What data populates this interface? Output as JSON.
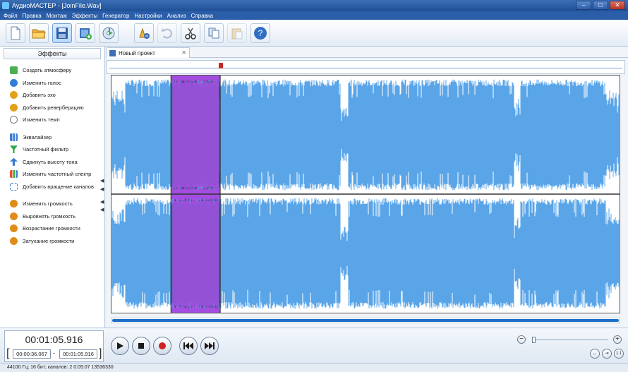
{
  "window": {
    "title": "АудиоМАСТЕР - [JoinFile.Wav]",
    "minimize": "–",
    "maximize": "□",
    "close": "✕"
  },
  "menu": [
    "Файл",
    "Правка",
    "Монтаж",
    "Эффекты",
    "Генератор",
    "Настройки",
    "Анализ",
    "Справка"
  ],
  "toolbar": {
    "icons": [
      "new-file-icon",
      "open-folder-icon",
      "save-icon",
      "video-icon",
      "audio-disc-icon",
      "effects-icon",
      "undo-icon",
      "cut-icon",
      "copy-icon",
      "paste-icon",
      "help-icon"
    ],
    "help_label": "?"
  },
  "effects_panel": {
    "header": "Эффекты",
    "groups": [
      [
        "Создать атмосферу",
        "Изменить голос",
        "Добавить эхо",
        "Добавить реверберацию",
        "Изменить темп"
      ],
      [
        "Эквалайзер",
        "Частотный фильтр",
        "Сдвинуть высоту тона",
        "Изменить частотный спектр",
        "Добавить вращение каналов"
      ],
      [
        "Изменить громкость",
        "Выровнять громкость",
        "Возрастание громкости",
        "Затухание громкости"
      ]
    ],
    "colors": {
      "atmosphere": "#4caf50",
      "voice": "#2f7fd6",
      "echo": "#e0a21a",
      "reverb": "#e0a21a",
      "tempo": "#7a7a7a",
      "eq": "#3a7bd5",
      "filter": "#2fa84f",
      "pitch": "#3a7bd5",
      "spectrum": "#e0542a",
      "rotation": "#2f7fd6",
      "volume": "#e08b1a"
    }
  },
  "tab": {
    "label": "Новый проект",
    "close": "✕"
  },
  "waveform": {
    "wave_color": "#5aa5e8",
    "selection_color": "#a34ee0",
    "selection_start": 0.117,
    "selection_end": 0.214
  },
  "time": {
    "current": "00:01:05.916",
    "selection_start": "00:00:36.067",
    "selection_end": "00:01:05.916",
    "dash": "-",
    "bracket_left": "[",
    "bracket_right": "]"
  },
  "zoom": {
    "minus": "−",
    "plus": "+",
    "fit_labels": [
      "↔",
      "⇥",
      "1:1"
    ],
    "level": 0.02
  },
  "status": {
    "text": "44100 Гц; 16 бит; каналов: 2  0:05:07 13536330"
  }
}
